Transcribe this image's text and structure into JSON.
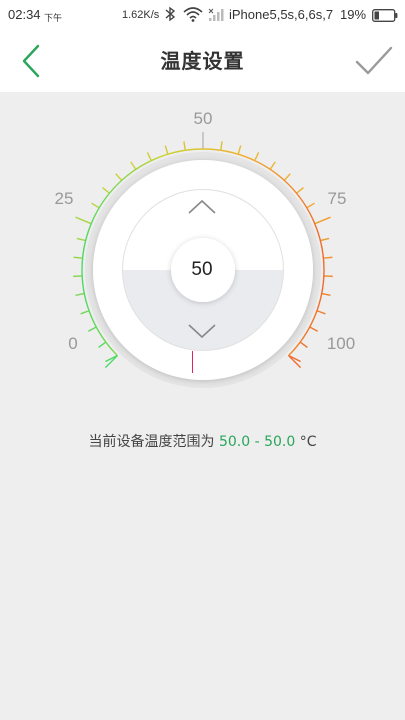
{
  "status_bar": {
    "time": "02:34",
    "ampm": "下午",
    "net_speed": "1.62K/s",
    "carrier": "iPhone5,5s,6,6s,7",
    "battery": "19%"
  },
  "nav": {
    "title": "温度设置",
    "back_icon": "chevron-left-icon",
    "confirm_icon": "check-icon",
    "accent_color": "#2aa65a"
  },
  "dial": {
    "min": 0,
    "max": 100,
    "value": "50",
    "scale_labels": [
      "0",
      "25",
      "50",
      "75",
      "100"
    ],
    "up_icon": "chevron-up-icon",
    "down_icon": "chevron-down-icon",
    "gradient_colors": [
      "#4cd964",
      "#c8d43a",
      "#f0b030",
      "#f06a2a"
    ]
  },
  "range": {
    "prefix": "当前设备温度范围为 ",
    "low": "50.0",
    "separator": " - ",
    "high": "50.0",
    "unit": " °C"
  }
}
